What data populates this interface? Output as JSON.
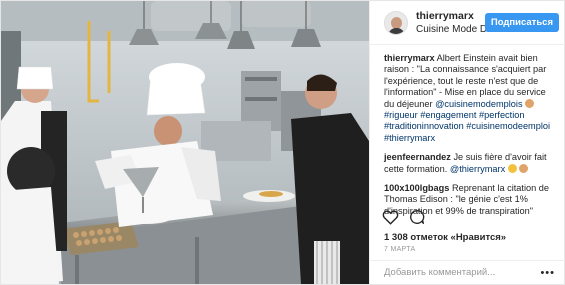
{
  "post": {
    "author": {
      "username": "thierrymarx",
      "location": "Cuisine Mode D'..."
    },
    "follow_label": "Подписаться",
    "caption": {
      "username": "thierrymarx",
      "text": "Albert Einstein avait bien raison : \"La connaissance s'acquiert par l'expérience, tout le reste n'est que de l'information\" - Mise en place du service du déjeuner",
      "mention": "@cuisinemodemplois",
      "hashtags_1": "#rigueur #engagement #perfection #traditioninnovation",
      "hashtags_2": "#cuisinemodeemploi #thierrymarx"
    },
    "comments": [
      {
        "username": "jeenfeernandez",
        "text": "Je suis fière d'avoir fait cette formation.",
        "mention": "@thierrymarx"
      },
      {
        "username": "100x100lgbags",
        "text": "Reprenant la citation de Thomas Edison : \"le génie c'est 1% d'inspiration et 99% de transpiration\""
      }
    ],
    "likes_text": "1 308 отметок «Нравится»",
    "date_text": "7 МАРТА",
    "add_comment_placeholder": "Добавить комментарий...",
    "more_label": "•••",
    "icons": {
      "like": "heart-icon",
      "comment": "comment-bubble-icon",
      "more": "more-options-icon"
    },
    "colors": {
      "follow_button": "#3897f0",
      "link": "#003569"
    }
  }
}
